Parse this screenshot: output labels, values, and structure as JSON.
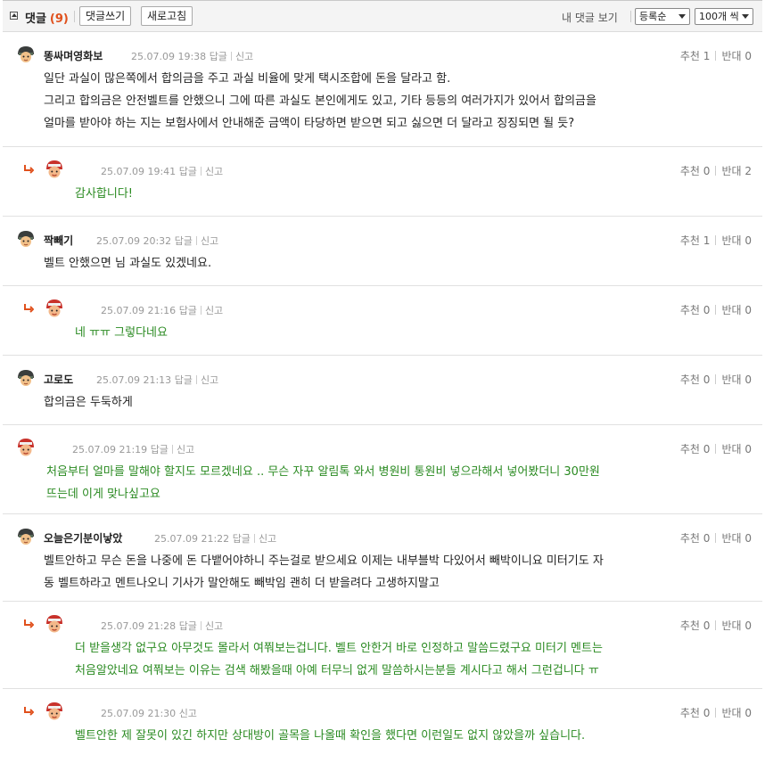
{
  "header": {
    "title": "댓글",
    "count": "(9)",
    "write_button": "댓글쓰기",
    "refresh_button": "새로고침",
    "my_comments": "내 댓글 보기",
    "sort_select": "등록순",
    "per_page_select": "100개 씩"
  },
  "labels": {
    "reply": "답글",
    "report": "신고",
    "recommend": "추천",
    "oppose": "반대"
  },
  "colors": {
    "accent": "#e0501c",
    "reply_text": "#2a8a21"
  },
  "comments": [
    {
      "nick": "똥싸며영화보",
      "time": "25.07.09 19:38",
      "recommend": "1",
      "oppose": "0",
      "avatar": "helmet-avatar",
      "has_reply_link": true,
      "lines": [
        "일단 과실이 많은쪽에서 합의금을 주고 과실 비율에 맞게 택시조합에 돈을 달라고 함.",
        "그리고 합의금은 안전벨트를 안했으니 그에 따른 과실도 본인에게도 있고, 기타 등등의 여러가지가 있어서 합의금을",
        "얼마를 받아야 하는 지는 보험사에서 안내해준 금액이 타당하면 받으면 되고 싫으면 더 달라고 징징되면 될 듯?"
      ]
    },
    {
      "nick": "",
      "time": "25.07.09 19:41",
      "recommend": "0",
      "oppose": "2",
      "avatar": "red-cap-avatar",
      "has_reply_link": true,
      "lines": [
        "감사합니다!"
      ]
    },
    {
      "nick": "짝빼기",
      "time": "25.07.09 20:32",
      "recommend": "1",
      "oppose": "0",
      "avatar": "helmet-avatar",
      "has_reply_link": true,
      "lines": [
        "벨트 안했으면 님 과실도 있겠네요."
      ]
    },
    {
      "nick": "",
      "time": "25.07.09 21:16",
      "recommend": "0",
      "oppose": "0",
      "avatar": "red-cap-avatar",
      "has_reply_link": true,
      "lines": [
        "네 ㅠㅠ 그렇다네요"
      ]
    },
    {
      "nick": "고로도",
      "time": "25.07.09 21:13",
      "recommend": "0",
      "oppose": "0",
      "avatar": "helmet-avatar",
      "has_reply_link": true,
      "lines": [
        "합의금은 두둑하게"
      ]
    },
    {
      "nick": "",
      "time": "25.07.09 21:19",
      "recommend": "0",
      "oppose": "0",
      "avatar": "red-cap-avatar",
      "has_reply_link": true,
      "lines": [
        "처음부터 얼마를 말해야 할지도 모르겠네요 .. 무슨 자꾸 알림톡 와서 병원비 통원비 넣으라해서 넣어봤더니 30만원",
        "뜨는데 이게 맞나싶고요"
      ]
    },
    {
      "nick": "오늘은기분이낳았",
      "time": "25.07.09 21:22",
      "recommend": "0",
      "oppose": "0",
      "avatar": "helmet-avatar",
      "has_reply_link": true,
      "lines": [
        "벨트안하고 무슨 돈을 나중에 돈 다뱉어야하니 주는걸로 받으세요 이제는 내부블박 다있어서 빼박이니요 미터기도 자",
        "동 벨트하라고 멘트나오니 기사가 말안해도 빼박임 괜히 더 받을려다 고생하지말고"
      ]
    },
    {
      "nick": "",
      "time": "25.07.09 21:28",
      "recommend": "0",
      "oppose": "0",
      "avatar": "red-cap-avatar",
      "has_reply_link": true,
      "lines": [
        "더 받을생각 없구요 아무것도 몰라서 여쭤보는겁니다. 벨트 안한거 바로 인정하고 말씀드렸구요 미터기 멘트는",
        "처음알았네요 여쭤보는 이유는 검색 해봤을때 아예 터무늬 없게 말씀하시는분들 계시다고 해서 그런겁니다 ㅠ"
      ]
    },
    {
      "nick": "",
      "time": "25.07.09 21:30",
      "recommend": "0",
      "oppose": "0",
      "avatar": "red-cap-avatar",
      "has_reply_link": false,
      "lines": [
        "벨트안한 제 잘못이 있긴 하지만 상대방이 골목을 나올때 확인을 했다면 이런일도 없지 않았을까 싶습니다."
      ]
    }
  ]
}
